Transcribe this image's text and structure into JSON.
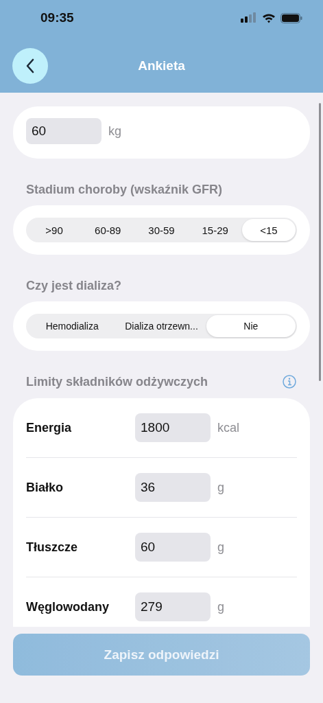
{
  "status_bar": {
    "time": "09:35"
  },
  "header": {
    "title": "Ankieta"
  },
  "weight": {
    "value": "60",
    "unit": "kg"
  },
  "stage": {
    "label": "Stadium choroby (wskaźnik GFR)",
    "options": [
      {
        "label": ">90",
        "selected": false
      },
      {
        "label": "60-89",
        "selected": false
      },
      {
        "label": "30-59",
        "selected": false
      },
      {
        "label": "15-29",
        "selected": false
      },
      {
        "label": "<15",
        "selected": true
      }
    ]
  },
  "dialysis": {
    "label": "Czy jest dializa?",
    "options": [
      {
        "label": "Hemodializa",
        "selected": false
      },
      {
        "label": "Dializa otrzewn...",
        "selected": false
      },
      {
        "label": "Nie",
        "selected": true
      }
    ]
  },
  "nutrients": {
    "label": "Limity składników odżywczych",
    "items": [
      {
        "name": "Energia",
        "value": "1800",
        "unit": "kcal"
      },
      {
        "name": "Białko",
        "value": "36",
        "unit": "g"
      },
      {
        "name": "Tłuszcze",
        "value": "60",
        "unit": "g"
      },
      {
        "name": "Węglowodany",
        "value": "279",
        "unit": "g"
      }
    ]
  },
  "save_button": {
    "label": "Zapisz odpowiedzi",
    "disabled": true
  }
}
